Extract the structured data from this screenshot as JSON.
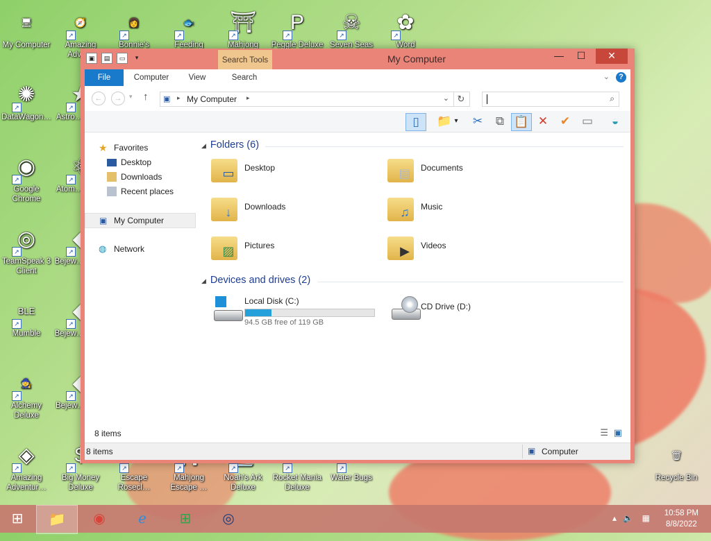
{
  "desktop": {
    "icons": [
      {
        "label": "My Computer",
        "glyph": "🖥",
        "shortcut": false
      },
      {
        "label": "Amazing Adve…",
        "glyph": "🧭",
        "shortcut": true
      },
      {
        "label": "Bonnie's",
        "glyph": "👩",
        "shortcut": true
      },
      {
        "label": "Feeding",
        "glyph": "🐟",
        "shortcut": true
      },
      {
        "label": "Mahjong",
        "glyph": "⛩",
        "shortcut": true
      },
      {
        "label": "Peggle Deluxe",
        "glyph": "P",
        "shortcut": true
      },
      {
        "label": "Seven Seas",
        "glyph": "☠",
        "shortcut": true
      },
      {
        "label": "Word",
        "glyph": "✿",
        "shortcut": true
      },
      {
        "label": "DataWagon…",
        "glyph": "✺",
        "shortcut": true
      },
      {
        "label": "Astro… Del…",
        "glyph": "★",
        "shortcut": true
      },
      {
        "label": "Google Chrome",
        "glyph": "◉",
        "shortcut": true
      },
      {
        "label": "Atom… Del…",
        "glyph": "⚛",
        "shortcut": true
      },
      {
        "label": "TeamSpeak 3 Client",
        "glyph": "◎",
        "shortcut": true
      },
      {
        "label": "Bejew… Del…",
        "glyph": "◆",
        "shortcut": true
      },
      {
        "label": "Mumble",
        "glyph": "BLE",
        "shortcut": true
      },
      {
        "label": "Bejew… Del…",
        "glyph": "◆",
        "shortcut": true
      },
      {
        "label": "Alchemy Deluxe",
        "glyph": "🧙",
        "shortcut": true
      },
      {
        "label": "Bejew… Tw…",
        "glyph": "◆",
        "shortcut": true
      },
      {
        "label": "Amazing Adventur…",
        "glyph": "◈",
        "shortcut": true
      },
      {
        "label": "Big Money Deluxe",
        "glyph": "$",
        "shortcut": true
      },
      {
        "label": "Escape Rosecl…",
        "glyph": "🌹",
        "shortcut": true
      },
      {
        "label": "Mahjong Escape …",
        "glyph": "⛩",
        "shortcut": true
      },
      {
        "label": "Noah's Ark Deluxe",
        "glyph": "⛵",
        "shortcut": true
      },
      {
        "label": "Rocket Mania Deluxe",
        "glyph": "🚀",
        "shortcut": true
      },
      {
        "label": "Water Bugs",
        "glyph": "🐞",
        "shortcut": true
      },
      {
        "label": "Recycle Bin",
        "glyph": "🗑",
        "shortcut": false
      }
    ]
  },
  "window": {
    "title": "My Computer",
    "search_tools": "Search Tools",
    "controls": {
      "minimize": "—",
      "maximize": "☐",
      "close": "✕"
    },
    "ribbon": {
      "file": "File",
      "tabs": [
        "Computer",
        "View",
        "Search"
      ],
      "help": "?"
    },
    "address": {
      "path": "My Computer",
      "separator": "▸"
    },
    "nav": {
      "favorites": "Favorites",
      "favorites_items": [
        "Desktop",
        "Downloads",
        "Recent places"
      ],
      "computer": "My Computer",
      "network": "Network"
    },
    "folders_header": "Folders (6)",
    "folders": [
      "Desktop",
      "Documents",
      "Downloads",
      "Music",
      "Pictures",
      "Videos"
    ],
    "drives_header": "Devices and drives (2)",
    "drives": [
      {
        "name": "Local Disk (C:)",
        "free": "94.5 GB free of 119 GB",
        "used_fraction": 0.206
      },
      {
        "name": "CD Drive (D:)"
      }
    ],
    "items_count": "8 items",
    "status_count": "8 items",
    "status_location": "Computer"
  },
  "taskbar": {
    "time": "10:58 PM",
    "date": "8/8/2022"
  },
  "colors": {
    "window_frame": "#ea8479",
    "accent_blue": "#1979ca",
    "progress": "#26a0da",
    "taskbar": "#c4786e"
  }
}
